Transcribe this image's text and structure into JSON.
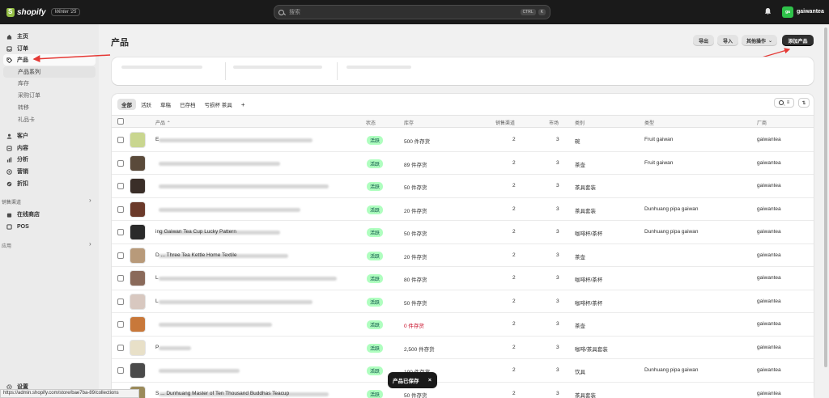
{
  "topbar": {
    "logo_text": "shopify",
    "edition": "Winter '25",
    "search_placeholder": "搜索",
    "kbd1": "CTRL",
    "kbd2": "K",
    "avatar_initials": "ga",
    "store_name": "gaiwantea"
  },
  "sidebar": {
    "home": "主页",
    "orders": "订单",
    "products": "产品",
    "sub": [
      "产品系列",
      "库存",
      "采购订单",
      "转移",
      "礼品卡"
    ],
    "customers": "客户",
    "content": "内容",
    "analytics": "分析",
    "marketing": "营销",
    "discounts": "折扣",
    "sales_channels": "销售渠道",
    "online_store": "在线商店",
    "pos": "POS",
    "apps": "应用",
    "settings": "设置"
  },
  "status_url": "https://admin.shopify.com/store/bae7ba-89/collections",
  "page": {
    "title": "产品",
    "export": "导出",
    "import": "导入",
    "more": "其他操作",
    "add": "添加产品"
  },
  "tabs": [
    "全部",
    "活跃",
    "草稿",
    "已存档",
    "亏损杯 茶具"
  ],
  "tab_add": "+",
  "columns": {
    "product": "产品",
    "status": "状态",
    "inventory": "库存",
    "channels": "销售渠道",
    "markets": "市场",
    "category": "类别",
    "type": "类型",
    "vendor": "厂商"
  },
  "rows": [
    {
      "title": "E",
      "status": "活跃",
      "inventory": "500 件存货",
      "channels": "2",
      "markets": "3",
      "category": "碗",
      "type": "Fruit gaiwan",
      "vendor": "gaiwantea",
      "thumb": "#c9d68f",
      "red": false
    },
    {
      "title": "",
      "status": "活跃",
      "inventory": "89 件存货",
      "channels": "2",
      "markets": "3",
      "category": "茶壶",
      "type": "Fruit gaiwan",
      "vendor": "gaiwantea",
      "thumb": "#5a4a3a",
      "red": false
    },
    {
      "title": "",
      "status": "活跃",
      "inventory": "50 件存货",
      "channels": "2",
      "markets": "3",
      "category": "茶具套装",
      "type": "",
      "vendor": "gaiwantea",
      "thumb": "#3a2e28",
      "red": false
    },
    {
      "title": "",
      "status": "活跃",
      "inventory": "20 件存货",
      "channels": "2",
      "markets": "3",
      "category": "茶具套装",
      "type": "Dunhuang pipa gaiwan",
      "vendor": "gaiwantea",
      "thumb": "#6b3a2a",
      "red": false
    },
    {
      "title": "ing Gaiwan Tea Cup Lucky Pattern",
      "status": "活跃",
      "inventory": "50 件存货",
      "channels": "2",
      "markets": "3",
      "category": "咖啡杯/茶杯",
      "type": "Dunhuang pipa gaiwan",
      "vendor": "gaiwantea",
      "thumb": "#2a2a2a",
      "red": false
    },
    {
      "title": "D ... Three Tea Kettle Home Textile",
      "status": "活跃",
      "inventory": "20 件存货",
      "channels": "2",
      "markets": "3",
      "category": "茶壶",
      "type": "",
      "vendor": "gaiwantea",
      "thumb": "#b89a7a",
      "red": false
    },
    {
      "title": "L",
      "status": "活跃",
      "inventory": "80 件存货",
      "channels": "2",
      "markets": "3",
      "category": "咖啡杯/茶杯",
      "type": "",
      "vendor": "gaiwantea",
      "thumb": "#8a6a5a",
      "red": false
    },
    {
      "title": "L",
      "status": "活跃",
      "inventory": "50 件存货",
      "channels": "2",
      "markets": "3",
      "category": "咖啡杯/茶杯",
      "type": "",
      "vendor": "gaiwantea",
      "thumb": "#d8c8c0",
      "red": false
    },
    {
      "title": "",
      "status": "活跃",
      "inventory": "0 件存货",
      "channels": "2",
      "markets": "3",
      "category": "茶壶",
      "type": "",
      "vendor": "gaiwantea",
      "thumb": "#c8783a",
      "red": true
    },
    {
      "title": "P",
      "status": "活跃",
      "inventory": "2,500 件存货",
      "channels": "2",
      "markets": "3",
      "category": "咖啡/茶具套装",
      "type": "",
      "vendor": "gaiwantea",
      "thumb": "#e8e0c8",
      "red": false
    },
    {
      "title": "",
      "status": "活跃",
      "inventory": "100 件存货",
      "channels": "2",
      "markets": "3",
      "category": "饮具",
      "type": "Dunhuang pipa gaiwan",
      "vendor": "gaiwantea",
      "thumb": "#4a4a4a",
      "red": false
    },
    {
      "title": "S ... Dunhuang Master of Ten Thousand Buddhas Teacup",
      "status": "活跃",
      "inventory": "50 件存货",
      "channels": "2",
      "markets": "3",
      "category": "茶具套装",
      "type": "",
      "vendor": "gaiwantea",
      "thumb": "#9a8a5a",
      "red": false
    }
  ],
  "toast": {
    "text": "产品已保存",
    "close": "×"
  }
}
